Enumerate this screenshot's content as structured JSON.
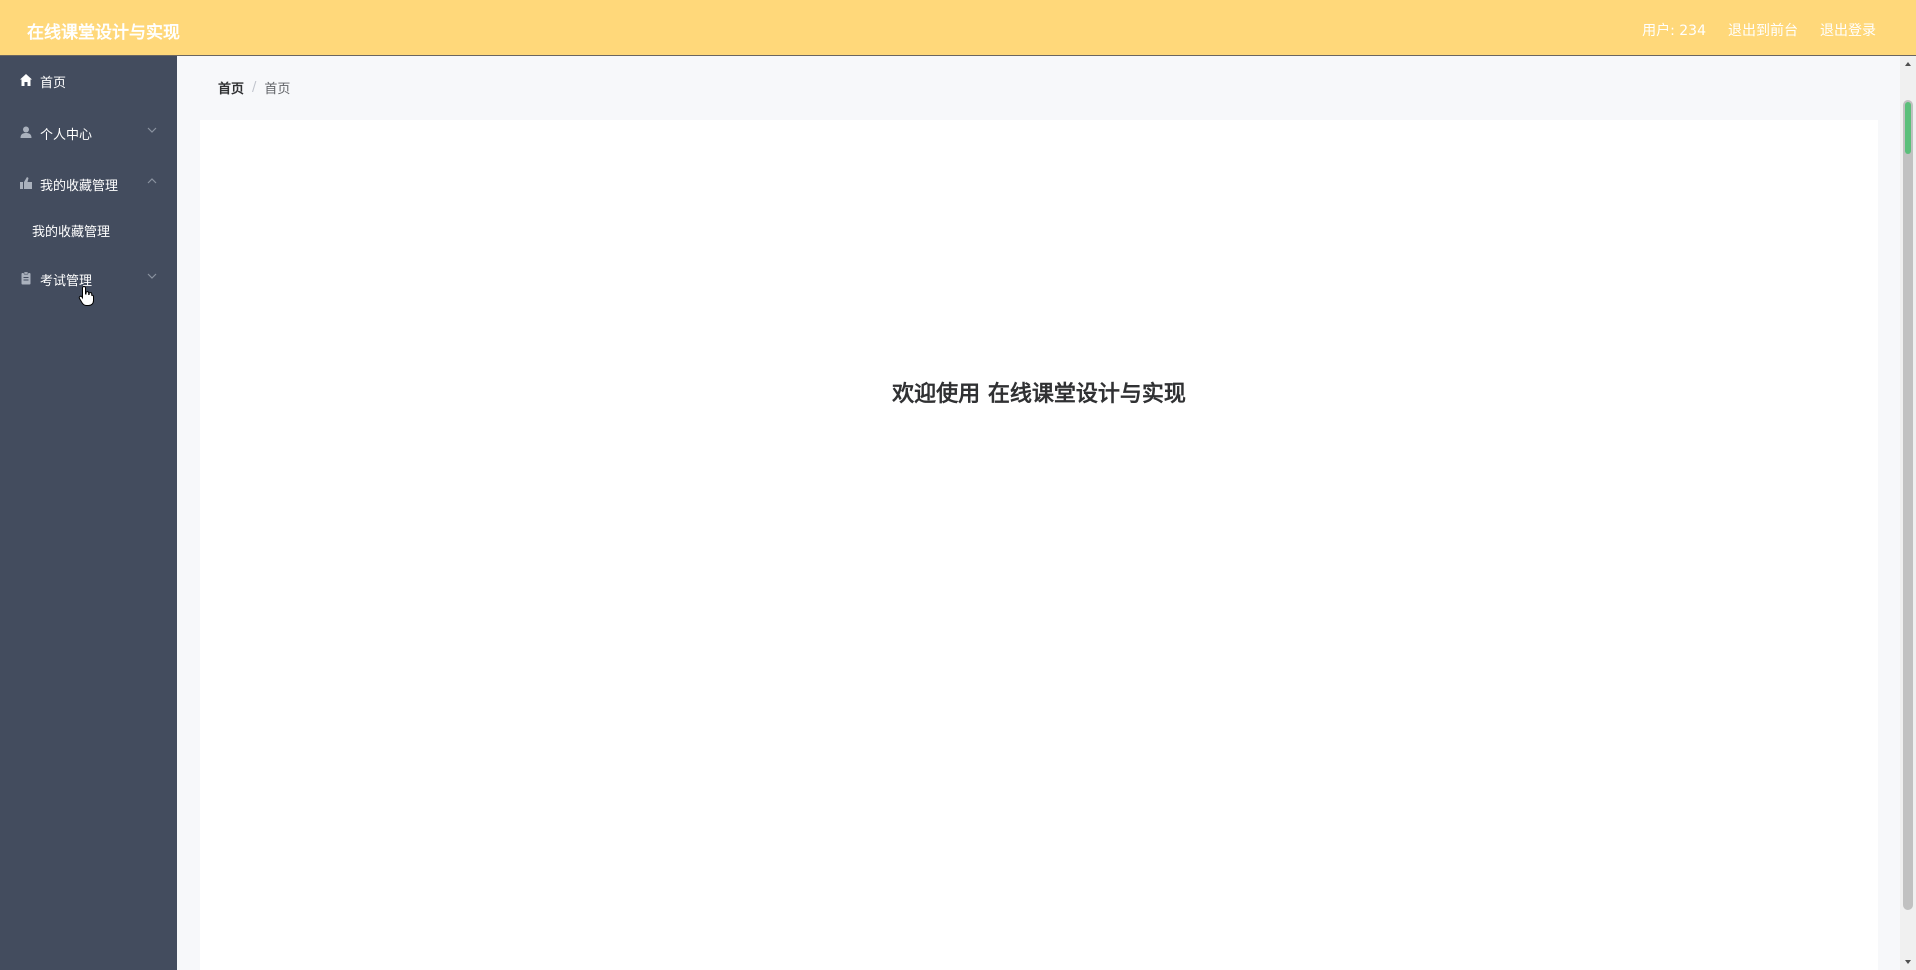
{
  "header": {
    "title": "在线课堂设计与实现",
    "user": "用户: 234",
    "to_front": "退出到前台",
    "logout": "退出登录"
  },
  "sidebar": {
    "items": [
      {
        "label": "首页",
        "icon": "home-icon"
      },
      {
        "label": "个人中心",
        "icon": "user-icon",
        "expanded": false
      },
      {
        "label": "我的收藏管理",
        "icon": "collection-icon",
        "expanded": true,
        "children": [
          {
            "label": "我的收藏管理"
          }
        ]
      },
      {
        "label": "考试管理",
        "icon": "clipboard-icon",
        "expanded": false
      }
    ]
  },
  "breadcrumb": {
    "first": "首页",
    "current": "首页"
  },
  "main": {
    "welcome": "欢迎使用 在线课堂设计与实现"
  },
  "colors": {
    "header_bg": "#ffd87a",
    "sidebar_bg": "#434c5e",
    "content_bg": "#ffffff"
  }
}
